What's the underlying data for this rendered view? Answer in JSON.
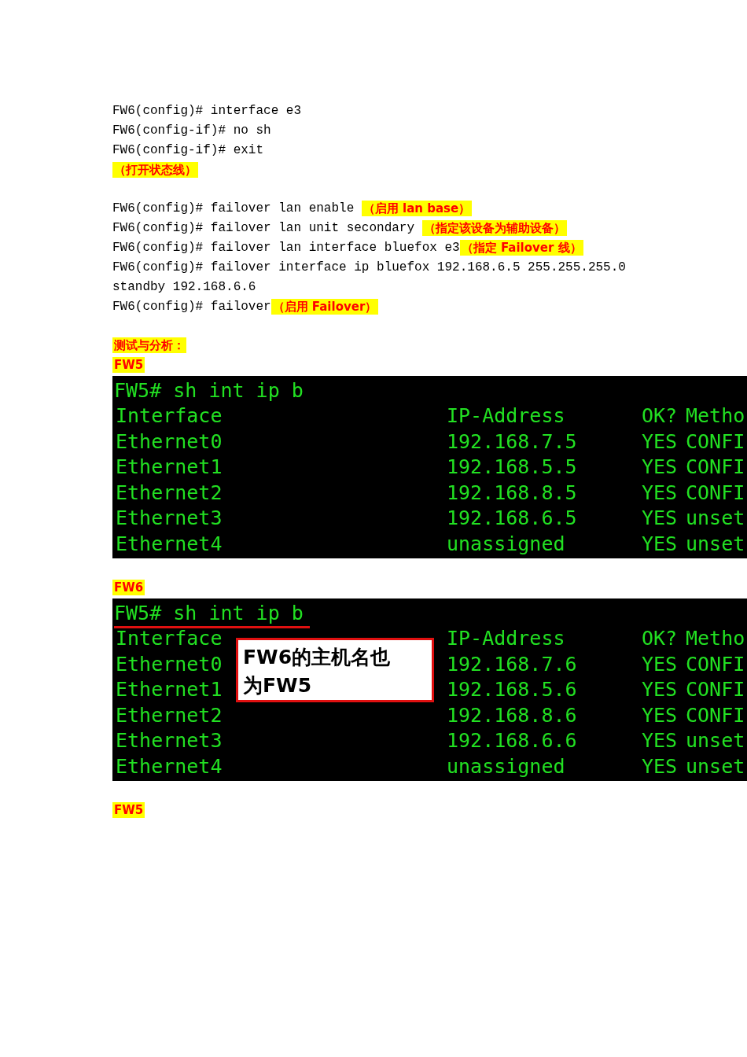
{
  "blocks": [
    {
      "kind": "code",
      "lines": [
        {
          "command": "FW6(config)# interface e3"
        },
        {
          "command": "FW6(config-if)# no sh"
        },
        {
          "command": "FW6(config-if)# exit"
        },
        {
          "note": "（打开状态线）"
        }
      ]
    },
    {
      "kind": "code",
      "lines": [
        {
          "command": "FW6(config)# failover lan enable ",
          "note": "（启用 lan base）"
        },
        {
          "command": "FW6(config)# failover lan unit secondary ",
          "note": "（指定该设备为辅助设备）"
        },
        {
          "command": "FW6(config)# failover lan interface bluefox e3",
          "note": "（指定 Failover 线）"
        },
        {
          "command": "FW6(config)# failover interface ip bluefox 192.168.6.5 255.255.255.0"
        },
        {
          "command": "standby 192.168.6.6"
        },
        {
          "command": "FW6(config)# failover",
          "note": "（启用 Failover）"
        }
      ]
    },
    {
      "kind": "label",
      "text": "测试与分析："
    },
    {
      "kind": "label",
      "text": "FW5"
    },
    {
      "kind": "terminal",
      "prompt": "FW5# sh int ip b",
      "prompt_underlined": false,
      "header": [
        "Interface",
        "IP-Address",
        "OK?",
        "Metho"
      ],
      "rows": [
        [
          "Ethernet0",
          "192.168.7.5",
          "YES",
          "CONFI"
        ],
        [
          "Ethernet1",
          "192.168.5.5",
          "YES",
          "CONFI"
        ],
        [
          "Ethernet2",
          "192.168.8.5",
          "YES",
          "CONFI"
        ],
        [
          "Ethernet3",
          "192.168.6.5",
          "YES",
          "unset"
        ],
        [
          "Ethernet4",
          "unassigned",
          "YES",
          "unset"
        ]
      ]
    },
    {
      "kind": "label",
      "text": "FW6"
    },
    {
      "kind": "terminal",
      "prompt": "FW5# sh int ip b",
      "prompt_underlined": true,
      "callout": "FW6的主机名也为FW5",
      "header": [
        "Interface",
        "IP-Address",
        "OK?",
        "Metho"
      ],
      "rows": [
        [
          "Ethernet0",
          "192.168.7.6",
          "YES",
          "CONFI"
        ],
        [
          "Ethernet1",
          "192.168.5.6",
          "YES",
          "CONFI"
        ],
        [
          "Ethernet2",
          "192.168.8.6",
          "YES",
          "CONFI"
        ],
        [
          "Ethernet3",
          "192.168.6.6",
          "YES",
          "unset"
        ],
        [
          "Ethernet4",
          "unassigned",
          "YES",
          "unset"
        ]
      ]
    },
    {
      "kind": "label",
      "text": "FW5"
    }
  ]
}
